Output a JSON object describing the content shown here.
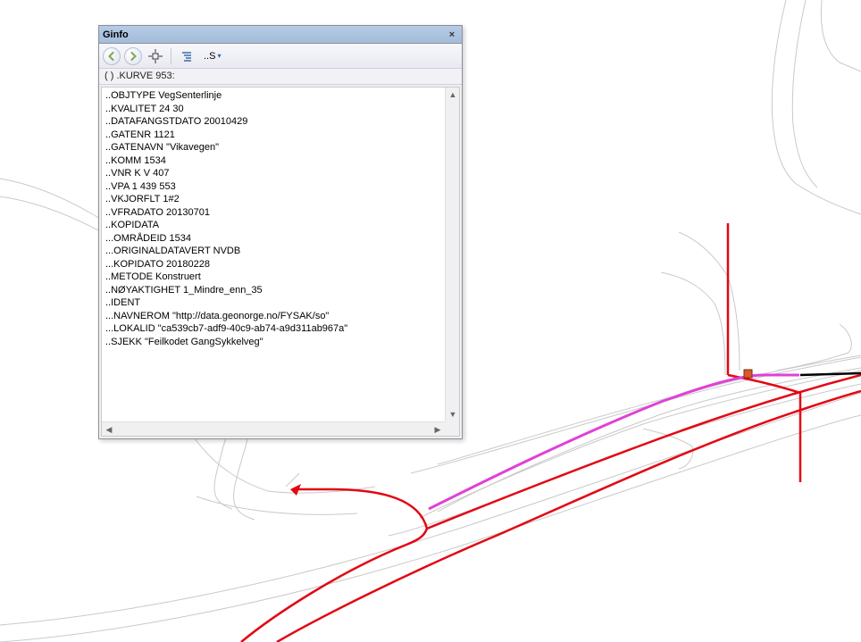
{
  "window": {
    "title": "Ginfo",
    "close_label": "×"
  },
  "toolbar": {
    "back_icon": "back-arrow",
    "forward_icon": "forward-arrow",
    "target_icon": "target",
    "list_icon": "list-lines",
    "dropdown_label": "..S"
  },
  "status": "( ) .KURVE 953:",
  "info_lines": [
    "..OBJTYPE VegSenterlinje",
    "..KVALITET 24 30",
    "..DATAFANGSTDATO 20010429",
    "..GATENR 1121",
    "..GATENAVN \"Vikavegen\"",
    "..KOMM 1534",
    "..VNR K V 407",
    "..VPA 1 439 553",
    "..VKJORFLT 1#2",
    "..VFRADATO 20130701",
    "..KOPIDATA",
    "...OMRÅDEID 1534",
    "...ORIGINALDATAVERT NVDB",
    "...KOPIDATO 20180228",
    "..METODE Konstruert",
    "..NØYAKTIGHET 1_Mindre_enn_35",
    "..IDENT",
    "...NAVNEROM \"http://data.geonorge.no/FYSAK/so\"",
    "...LOKALID \"ca539cb7-adf9-40c9-ab74-a9d311ab967a\"",
    "..SJEKK \"Feilkodet GangSykkelveg\""
  ],
  "map": {
    "colors": {
      "background_lines": "#c9c9c9",
      "highlight_road": "#e30613",
      "selected_segment": "#e041d8",
      "black_line": "#000000",
      "marker_fill": "#d85a2c",
      "marker_stroke": "#7a2e10"
    }
  }
}
